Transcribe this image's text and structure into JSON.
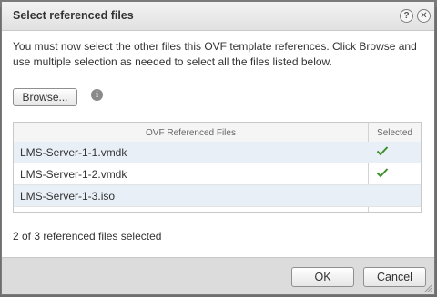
{
  "dialog": {
    "title": "Select referenced files",
    "instructions": "You must now select the other files this OVF template references. Click Browse and use multiple selection as needed to select all the files listed below.",
    "browse_label": "Browse...",
    "status": "2 of 3 referenced files selected",
    "ok_label": "OK",
    "cancel_label": "Cancel"
  },
  "grid": {
    "columns": [
      "OVF Referenced Files",
      "Selected"
    ],
    "rows": [
      {
        "file": "LMS-Server-1-1.vmdk",
        "selected": true
      },
      {
        "file": "LMS-Server-1-2.vmdk",
        "selected": true
      },
      {
        "file": "LMS-Server-1-3.iso",
        "selected": false
      }
    ]
  },
  "icons": {
    "help": "help-icon",
    "close": "close-icon",
    "info": "info-icon",
    "check": "checkmark-icon"
  },
  "colors": {
    "check": "#3a8f2a",
    "row_alt": "#e8eff6"
  }
}
